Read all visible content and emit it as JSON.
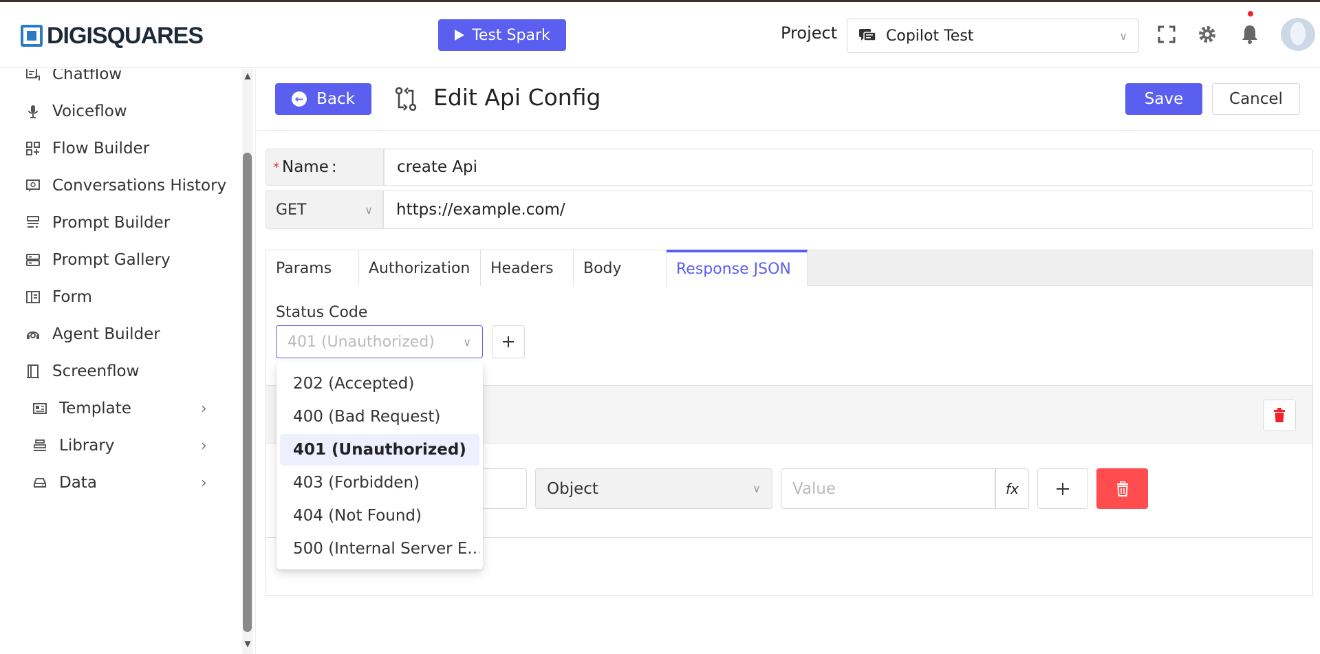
{
  "brand": {
    "name": "DIGISQUARES",
    "color": "#2c7bc0"
  },
  "colors": {
    "accent": "#5b5ff0",
    "danger": "#ff4d4f",
    "required": "#f5222d"
  },
  "header": {
    "test_button": "Test Spark",
    "project_label": "Project",
    "project_value": "Copilot Test"
  },
  "sidebar": {
    "items": [
      {
        "label": "Chatflow",
        "icon": "chatflow-icon"
      },
      {
        "label": "Voiceflow",
        "icon": "microphone-icon"
      },
      {
        "label": "Flow Builder",
        "icon": "flow-builder-icon"
      },
      {
        "label": "Conversations History",
        "icon": "history-icon"
      },
      {
        "label": "Prompt Builder",
        "icon": "prompt-builder-icon"
      },
      {
        "label": "Prompt Gallery",
        "icon": "gallery-icon"
      },
      {
        "label": "Form",
        "icon": "form-icon"
      },
      {
        "label": "Agent Builder",
        "icon": "agent-icon"
      },
      {
        "label": "Screenflow",
        "icon": "screenflow-icon"
      },
      {
        "label": "Template",
        "icon": "template-icon"
      },
      {
        "label": "Library",
        "icon": "library-icon"
      },
      {
        "label": "Data",
        "icon": "data-icon"
      }
    ]
  },
  "page": {
    "back_label": "Back",
    "title": "Edit Api Config",
    "save_label": "Save",
    "cancel_label": "Cancel"
  },
  "form": {
    "name_label": "Name",
    "name_colon": ":",
    "name_required_mark": "*",
    "name_value": "create Api",
    "method": "GET",
    "url": "https://example.com/"
  },
  "tabs": [
    "Params",
    "Authorization",
    "Headers",
    "Body",
    "Response JSON"
  ],
  "active_tab": "Response JSON",
  "response": {
    "status_label": "Status Code",
    "status_value": "401 (Unauthorized)",
    "type_value": "Object",
    "value_placeholder": "Value",
    "fx_label": "fx"
  },
  "dropdown": {
    "options": [
      "202 (Accepted)",
      "400 (Bad Request)",
      "401 (Unauthorized)",
      "403 (Forbidden)",
      "404 (Not Found)",
      "500 (Internal Server E..."
    ],
    "selected": "401 (Unauthorized)"
  }
}
